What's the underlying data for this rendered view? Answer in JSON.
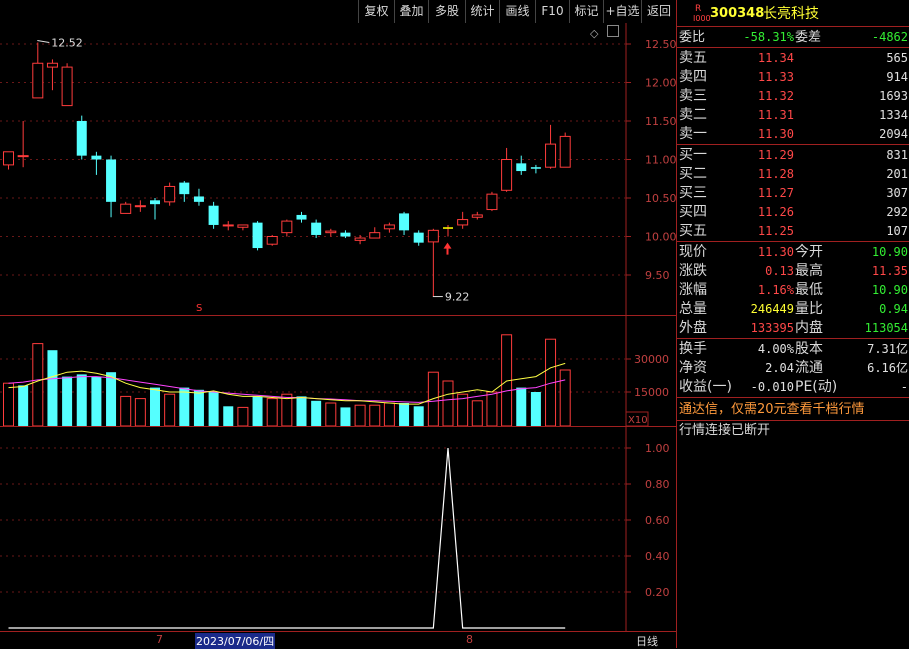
{
  "toolbar": {
    "buttons": [
      "复权",
      "叠加",
      "多股",
      "统计",
      "画线",
      "F10",
      "标记",
      "+自选",
      "返回"
    ]
  },
  "main_chart": {
    "price_axis": [
      "12.50",
      "12.00",
      "11.50",
      "11.00",
      "10.50",
      "10.00",
      "9.50"
    ],
    "high_label": "12.52",
    "low_label": "9.22",
    "s_marker": "S",
    "colors": {
      "up": "#ff3c3c",
      "down": "#55ffff",
      "ma5": "#ffff44",
      "ma10": "#ff44ff"
    }
  },
  "volume_chart": {
    "axis": [
      "30000",
      "15000"
    ],
    "unit": "X10"
  },
  "indicator_chart": {
    "axis": [
      "1.00",
      "0.80",
      "0.60",
      "0.40",
      "0.20"
    ]
  },
  "date_bar": {
    "month_7": "7",
    "cursor_date": "2023/07/06/四",
    "month_8": "8",
    "period": "日线"
  },
  "quote": {
    "r_badge": "R",
    "code_small": "I000",
    "code": "300348",
    "name": "长亮科技",
    "weibi_label": "委比",
    "weibi_value": "-58.31%",
    "weicha_label": "委差",
    "weicha_value": "-4862",
    "sells": [
      {
        "label": "卖五",
        "price": "11.34",
        "vol": "565"
      },
      {
        "label": "卖四",
        "price": "11.33",
        "vol": "914"
      },
      {
        "label": "卖三",
        "price": "11.32",
        "vol": "1693"
      },
      {
        "label": "卖二",
        "price": "11.31",
        "vol": "1334"
      },
      {
        "label": "卖一",
        "price": "11.30",
        "vol": "2094"
      }
    ],
    "buys": [
      {
        "label": "买一",
        "price": "11.29",
        "vol": "831"
      },
      {
        "label": "买二",
        "price": "11.28",
        "vol": "201"
      },
      {
        "label": "买三",
        "price": "11.27",
        "vol": "307"
      },
      {
        "label": "买四",
        "price": "11.26",
        "vol": "292"
      },
      {
        "label": "买五",
        "price": "11.25",
        "vol": "107"
      }
    ],
    "stats": [
      {
        "l1": "现价",
        "v1": "11.30",
        "c1": "red",
        "l2": "今开",
        "v2": "10.90",
        "c2": "grn"
      },
      {
        "l1": "涨跌",
        "v1": "0.13",
        "c1": "red",
        "l2": "最高",
        "v2": "11.35",
        "c2": "red"
      },
      {
        "l1": "涨幅",
        "v1": "1.16%",
        "c1": "red",
        "l2": "最低",
        "v2": "10.90",
        "c2": "grn"
      },
      {
        "l1": "总量",
        "v1": "246449",
        "c1": "yel",
        "l2": "量比",
        "v2": "0.94",
        "c2": "grn"
      },
      {
        "l1": "外盘",
        "v1": "133395",
        "c1": "red",
        "l2": "内盘",
        "v2": "113054",
        "c2": "grn"
      }
    ],
    "fund": [
      {
        "l1": "换手",
        "v1": "4.00%",
        "l2": "股本",
        "v2": "7.31亿"
      },
      {
        "l1": "净资",
        "v1": "2.04",
        "l2": "流通",
        "v2": "6.16亿"
      },
      {
        "l1": "收益(一)",
        "v1": "-0.010",
        "l2": "PE(动)",
        "v2": "-"
      }
    ],
    "promo": "通达信，仅需20元查看千档行情",
    "status": "行情连接已断开"
  }
}
